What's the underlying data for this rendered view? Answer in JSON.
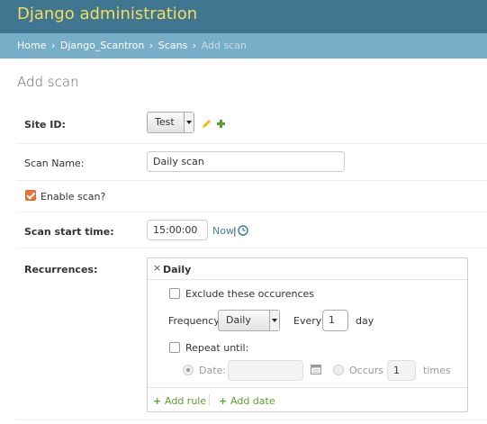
{
  "header": {
    "title": "Django administration"
  },
  "breadcrumbs": {
    "home": "Home",
    "app": "Django_Scantron",
    "model": "Scans",
    "current": "Add scan",
    "separator": "›"
  },
  "page": {
    "title": "Add scan"
  },
  "form": {
    "site": {
      "label": "Site ID:",
      "value": "Test"
    },
    "scan_name": {
      "label": "Scan Name:",
      "value": "Daily scan"
    },
    "enable_scan": {
      "label": "Enable scan?",
      "checked": true
    },
    "start_time": {
      "label": "Scan start time:",
      "value": "15:00:00",
      "now_link": "Now",
      "separator": "|"
    },
    "recurrences": {
      "label": "Recurrences:",
      "rule_remove": "×",
      "rule_name": "Daily",
      "exclude_label": "Exclude these occurences",
      "frequency_label": "Frequency:",
      "frequency_value": "Daily",
      "every_label": "Every",
      "every_value": "1",
      "unit_label": "day",
      "repeat_until_label": "Repeat until:",
      "date_label": "Date:",
      "date_value": "",
      "occurs_label": "Occurs",
      "occurs_value": "1",
      "times_label": "times",
      "add_rule": "Add rule",
      "add_date": "Add date",
      "plus": "+"
    }
  },
  "colors": {
    "header_bg": "#417690",
    "title": "#f5dd5d",
    "breadcrumbs_bg": "#79aec8",
    "link": "#447e9b",
    "add_green": "#5aa02c",
    "edit_yellow": "#efb80b",
    "checkbox_accent": "#e6763a"
  },
  "icons": {
    "edit": "pencil-icon",
    "add": "plus-icon",
    "clock": "clock-icon",
    "calendar": "calendar-icon",
    "remove": "close-icon"
  }
}
